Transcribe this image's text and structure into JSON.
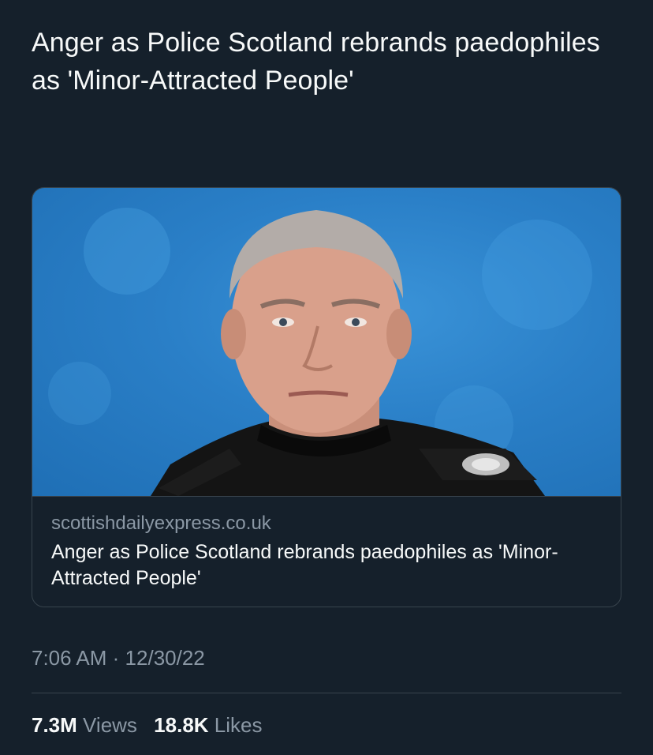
{
  "tweet": {
    "text": "Anger as Police Scotland rebrands paedophiles as 'Minor-Attracted People'"
  },
  "card": {
    "domain": "scottishdailyexpress.co.uk",
    "title": "Anger as Police Scotland rebrands paedophiles as 'Minor-Attracted People'"
  },
  "meta": {
    "time": "7:06 AM",
    "separator": "·",
    "date": "12/30/22"
  },
  "stats": {
    "views_count": "7.3M",
    "views_label": "Views",
    "likes_count": "18.8K",
    "likes_label": "Likes"
  },
  "colors": {
    "background": "#15202b",
    "text": "#f7f9f9",
    "secondary_text": "#8b98a5",
    "border": "#38444d"
  }
}
